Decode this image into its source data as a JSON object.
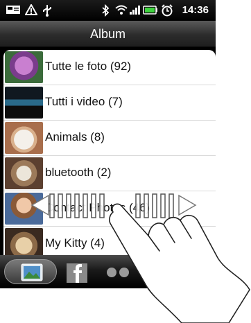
{
  "status_bar": {
    "time": "14:36",
    "icons": [
      "message-icon",
      "warning-icon",
      "usb-icon",
      "bluetooth-icon",
      "wifi-icon",
      "signal-icon",
      "battery-icon",
      "alarm-icon"
    ]
  },
  "header": {
    "title": "Album"
  },
  "albums": [
    {
      "label": "Tutte le foto  (92)"
    },
    {
      "label": "Tutti i video  (7)"
    },
    {
      "label": "Animals  (8)"
    },
    {
      "label": "bluetooth  (2)"
    },
    {
      "label": "Contact Photos  (46)"
    },
    {
      "label": "My Kitty  (4)"
    }
  ],
  "tabs": [
    "photos-tab",
    "facebook-tab",
    "flickr-tab"
  ],
  "colors": {
    "list_bg": "#ffffff",
    "bar_dark": "#1e1e1e",
    "divider": "#d9d9d9"
  }
}
